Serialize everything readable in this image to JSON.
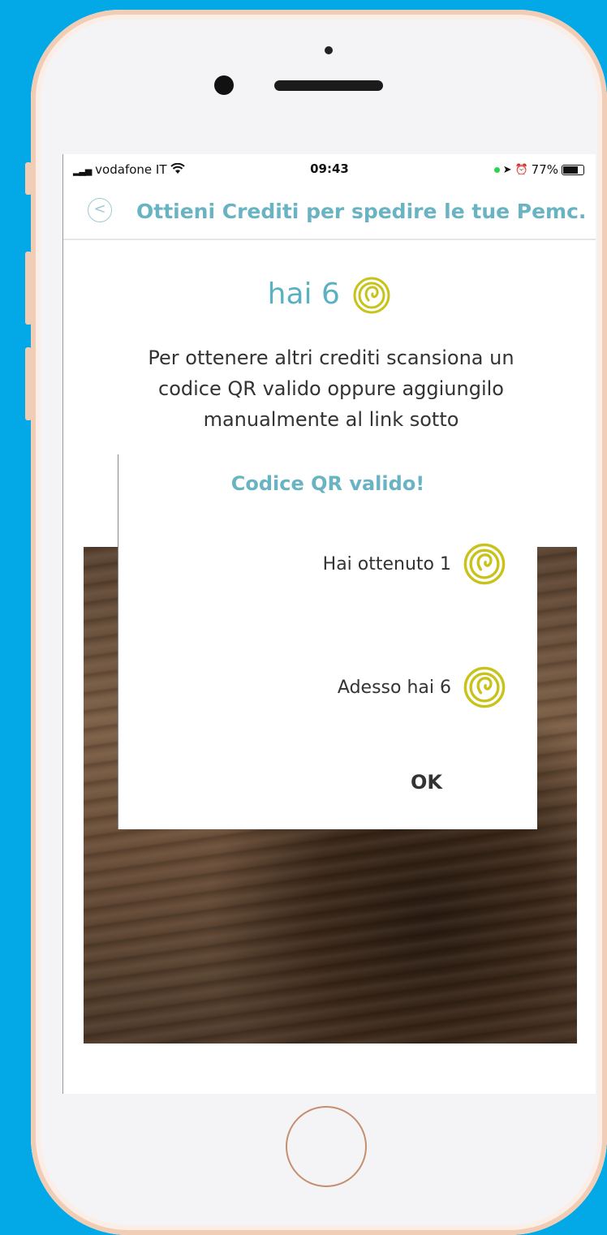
{
  "status_bar": {
    "carrier": "vodafone IT",
    "time": "09:43",
    "battery": "77%"
  },
  "nav": {
    "title": "Ottieni Crediti per spedire le tue Pemc..."
  },
  "credits": {
    "prefix": "hai",
    "count": "6"
  },
  "instructions": "Per ottenere altri crediti scansiona un codice QR valido oppure aggiungilo manualmente al link sotto",
  "modal": {
    "title": "Codice QR valido!",
    "gained_text": "Hai ottenuto 1",
    "now_text": "Adesso hai 6",
    "ok_label": "OK"
  },
  "colors": {
    "background": "#02a9e6",
    "accent_teal": "#6ab3c2",
    "coin_yellow": "#c8c21a"
  },
  "icons": [
    "back-arrow-icon",
    "credit-coin-icon",
    "wifi-icon",
    "location-icon",
    "alarm-icon",
    "battery-icon"
  ]
}
